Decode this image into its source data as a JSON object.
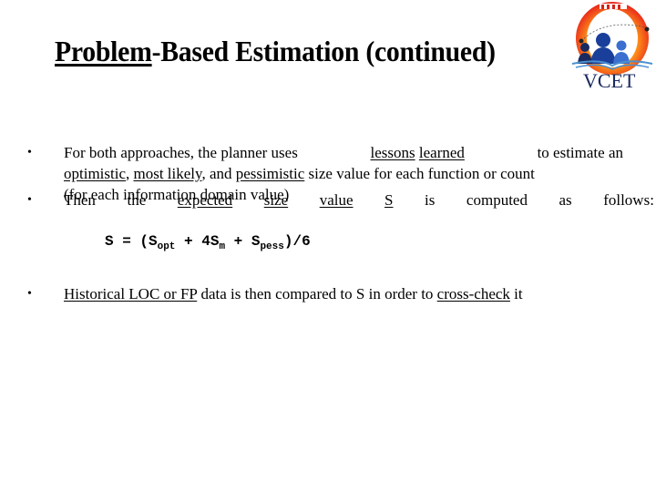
{
  "slide": {
    "title": {
      "underlined": "Problem",
      "rest": "-Based Estimation (continued)"
    },
    "logo": {
      "icon": "vcet-college-logo",
      "text": "VCET"
    },
    "bullets": [
      {
        "segments": {
          "l1_a": "For both approaches, the planner uses",
          "l1_u1": "lessons",
          "l1_u2": "learned",
          "l1_b": "to estimate an",
          "l2_u1": "optimistic",
          "l2_a": ",",
          "l2_u2": "most likely",
          "l2_b": ", and",
          "l2_u3": "pessimistic",
          "l2_c": "size value for each function or count",
          "l3": "(for each information domain value)"
        }
      },
      {
        "segments": {
          "w1": "Then",
          "w2": "the",
          "w3": "expected",
          "w4": "size",
          "w5": "value",
          "w6": "S",
          "w7": "is",
          "w8": "computed",
          "w9": "as",
          "w10": "follows:"
        }
      },
      {
        "segments": {
          "u1": "Historical LOC or FP",
          "a": "data is then compared to S in order to",
          "u2": "cross-check",
          "b": "it"
        }
      }
    ],
    "bullet_glyph": "•",
    "formula": {
      "lhs": "S = (S",
      "sub1": "opt",
      "mid1": " + 4S",
      "sub2": "m",
      "mid2": " + S",
      "sub3": "pess",
      "rhs": ")/6"
    }
  }
}
